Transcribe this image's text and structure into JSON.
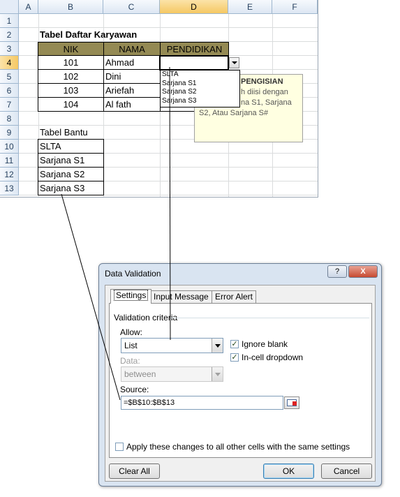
{
  "spreadsheet": {
    "columns": [
      "A",
      "B",
      "C",
      "D",
      "E",
      "F"
    ],
    "rows": [
      "1",
      "2",
      "3",
      "4",
      "5",
      "6",
      "7",
      "8",
      "9",
      "10",
      "11",
      "12",
      "13"
    ],
    "active_column": "D",
    "active_row": "4",
    "title": "Tabel Daftar Karyawan",
    "headers": [
      "NIK",
      "NAMA",
      "PENDIDIKAN"
    ],
    "records": [
      {
        "nik": "101",
        "nama": "Ahmad"
      },
      {
        "nik": "102",
        "nama": "Dini"
      },
      {
        "nik": "103",
        "nama": "Ariefah"
      },
      {
        "nik": "104",
        "nama": "Al fath"
      }
    ],
    "helper_title": "Tabel Bantu",
    "helper_items": [
      "SLTA",
      "Sarjana S1",
      "Sarjana S2",
      "Sarjana S3"
    ]
  },
  "dropdown": {
    "options": [
      "SLTA",
      "Sarjana S1",
      "Sarjana S2",
      "Sarjana S3"
    ]
  },
  "input_message": {
    "title": "PENGISIAN",
    "line1": "h diisi dengan",
    "line2": "na S1, Sarjana",
    "line3": "S2, Atau Sarjana S#"
  },
  "dialog": {
    "title": "Data Validation",
    "help_label": "?",
    "close_label": "X",
    "tabs": [
      "Settings",
      "Input Message",
      "Error Alert"
    ],
    "section_label": "Validation criteria",
    "allow_label": "Allow:",
    "allow_value": "List",
    "data_label": "Data:",
    "data_value": "between",
    "ignore_blank_label": "Ignore blank",
    "in_cell_dropdown_label": "In-cell dropdown",
    "ignore_blank_checked": true,
    "in_cell_dropdown_checked": true,
    "source_label": "Source:",
    "source_value": "=$B$10:$B$13",
    "apply_all_label": "Apply these changes to all other cells with the same settings",
    "apply_all_checked": false,
    "clear_all_label": "Clear All",
    "ok_label": "OK",
    "cancel_label": "Cancel",
    "check_mark": "✓"
  },
  "colors": {
    "header_fill": "#948a54",
    "tooltip_fill": "#ffffe1",
    "dialog_frame": "#d9e4f1",
    "active_header": "#f5c863"
  }
}
